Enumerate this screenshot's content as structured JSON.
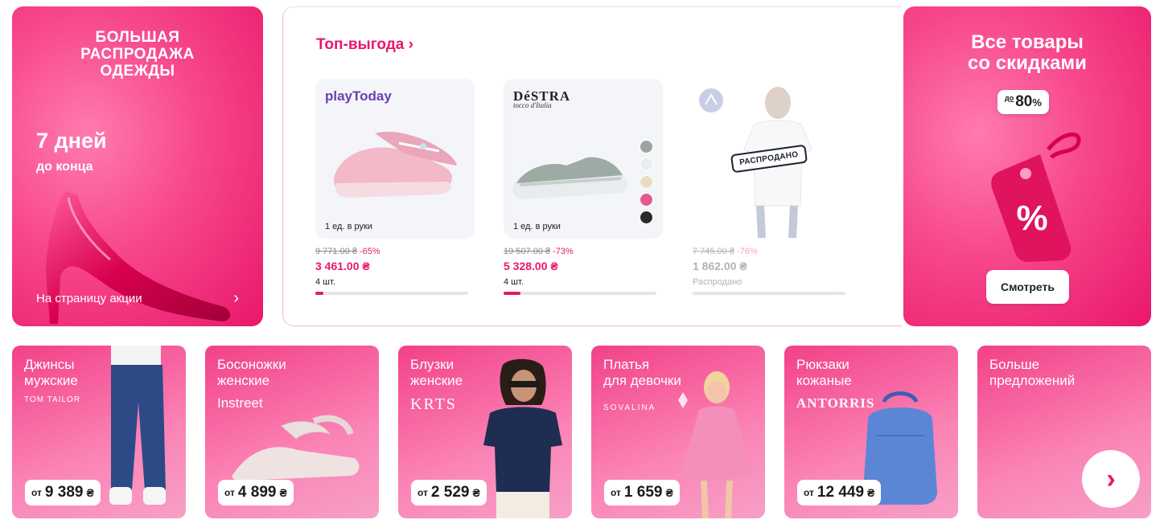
{
  "promo_left": {
    "title": "БОЛЬШАЯ\nРАСПРОДАЖА\nОДЕЖДЫ",
    "days": "7 дней",
    "days_sub": "до конца",
    "link": "На страницу акции",
    "chevron": "›"
  },
  "center": {
    "title": "Топ-выгода ›",
    "products": [
      {
        "brand": "playToday",
        "per_hand": "1 ед. в руки",
        "old_price": "9 771.00 ₴",
        "discount": "-65%",
        "price": "3 461.00 ₴",
        "qty": "4 шт.",
        "progress": 0.05
      },
      {
        "brand": "DéSTRA",
        "brand_sub": "tocco d'Italia",
        "per_hand": "1 ед. в руки",
        "old_price": "19 507.00 ₴",
        "discount": "-73%",
        "price": "5 328.00 ₴",
        "qty": "4 шт.",
        "progress": 0.11,
        "swatch_colors": [
          "#9ea3a0",
          "#e9edf0",
          "#e8dcc2",
          "#e45a8e",
          "#2b2b2b"
        ]
      },
      {
        "stamp": "РАСПРОДАНО",
        "old_price": "7 745.00 ₴",
        "discount": "-76%",
        "price": "1 862.00 ₴",
        "qty": "Распродано",
        "progress": 0
      }
    ]
  },
  "promo_right": {
    "title": "Все товары\nсо скидками",
    "badge_prefix": "до",
    "badge_value": "80",
    "badge_pct": "%",
    "tag_symbol": "%",
    "button": "Смотреть"
  },
  "cards": [
    {
      "label": "Джинсы\nмужские",
      "brand": "TOM TAILOR",
      "ot": "от",
      "price": "9 389",
      "cur": "₴"
    },
    {
      "label": "Босоножки\nженские",
      "brand": "Instreet",
      "ot": "от",
      "price": "4 899",
      "cur": "₴"
    },
    {
      "label": "Блузки\nженские",
      "brand": "KRTS",
      "ot": "от",
      "price": "2 529",
      "cur": "₴"
    },
    {
      "label": "Платья\nдля девочки",
      "brand": "SOVALINA",
      "ot": "от",
      "price": "1 659",
      "cur": "₴"
    },
    {
      "label": "Рюкзаки\nкожаные",
      "brand": "ANTORRIS",
      "ot": "от",
      "price": "12 449",
      "cur": "₴"
    },
    {
      "label": "Больше\nпредложений",
      "arrow": "›"
    }
  ],
  "colors": {
    "accent": "#e9176a",
    "accent_light": "#f7478c"
  }
}
